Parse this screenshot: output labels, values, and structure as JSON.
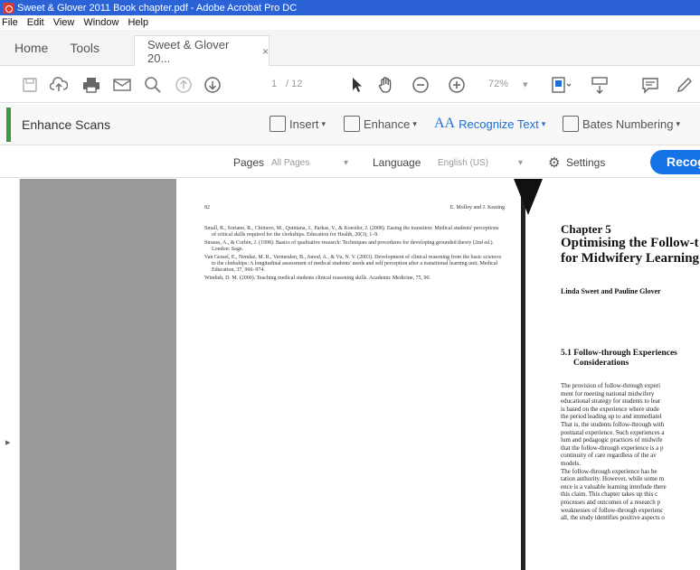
{
  "window": {
    "title": "Sweet & Glover 2011 Book chapter.pdf - Adobe Acrobat Pro DC"
  },
  "menu": [
    "File",
    "Edit",
    "View",
    "Window",
    "Help"
  ],
  "tabs": {
    "home": "Home",
    "tools": "Tools",
    "document": "Sweet & Glover 20...",
    "close": "×"
  },
  "toolbar": {
    "page_current": "1",
    "page_total": "/ 12",
    "zoom": "72%"
  },
  "tool": {
    "name": "Enhance Scans",
    "insert": "Insert",
    "enhance": "Enhance",
    "recognize_text": "Recognize Text",
    "bates": "Bates Numbering"
  },
  "options": {
    "pages_label": "Pages",
    "pages_value": "All Pages",
    "language_label": "Language",
    "language_value": "English (US)",
    "settings_label": "Settings",
    "recognize_button": "Recog"
  },
  "page1": {
    "page_number": "82",
    "running_head": "E. Molloy and J. Keating",
    "references": [
      "Small, R., Soriano, R., Chimero, M., Quintana, J., Parkas, V., & Koestler, J. (2008). Easing the transition: Medical students' perceptions of critical skills required for the clerkships. Education for Health, 20(3), 1–9.",
      "Strauss, A., & Corbin, J. (1998). Basics of qualitative research: Techniques and procedures for developing grounded theory (2nd ed.). London: Sage.",
      "Van Gessel, E., Nendaz, M. R., Vermeulen, B., Junod, A., & Vu, N. V. (2003). Development of clinical reasoning from the basic sciences to the clerkships: A longitudinal assessment of medical students' needs and self perception after a transitional learning unit. Medical Education, 37, 966–974.",
      "Windish, D. M. (2000). Teaching medical students clinical reasoning skills. Academic Medicine, 75, 90."
    ]
  },
  "page2": {
    "chapter_label": "Chapter 5",
    "title_line1": "Optimising the Follow-t",
    "title_line2": "for Midwifery Learning",
    "authors": "Linda Sweet and Pauline Glover",
    "section_line1": "5.1 Follow-through Experiences",
    "section_line2": "Considerations",
    "body_lines": [
      "The provision of follow-through experi",
      "ment for meeting national midwifery",
      "educational strategy for students to lear",
      "is based on the experience where stude",
      "the period leading up to and immediatel",
      "That is, the students follow-through with",
      "postnatal experience. Such experiences a",
      "lum and pedagogic practices of midwife",
      "that the follow-through experience is a p",
      "continuity of care regardless of the av",
      "models.",
      "   The follow-through experience has be",
      "tation authority. However, while some m",
      "ence is a valuable learning interlude there",
      "this claim. This chapter takes up this c",
      "processes and outcomes of a research p",
      "weaknesses of follow-through experienc",
      "all, the study identifies positive aspects o"
    ]
  }
}
